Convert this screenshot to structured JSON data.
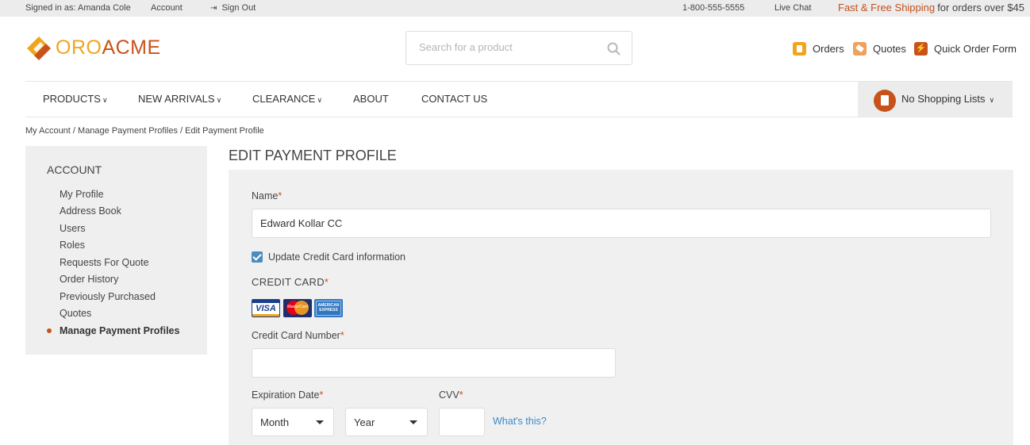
{
  "topbar": {
    "signed_in": "Signed in as: Amanda Cole",
    "account": "Account",
    "sign_out": "Sign Out",
    "phone": "1-800-555-5555",
    "live_chat": "Live Chat",
    "shipping_accent": "Fast & Free Shipping",
    "shipping_rest": "for orders over $45"
  },
  "brand": {
    "part1": "ORO",
    "part2": "ACME",
    "color1": "#f0a51d",
    "color2": "#c8531a"
  },
  "search": {
    "placeholder": "Search for a product",
    "icon": "search-icon"
  },
  "header_links": [
    {
      "label": "Orders",
      "icon": "orders-icon"
    },
    {
      "label": "Quotes",
      "icon": "quotes-icon"
    },
    {
      "label": "Quick Order Form",
      "icon": "quick-order-icon"
    }
  ],
  "nav": [
    {
      "label": "PRODUCTS",
      "dropdown": true
    },
    {
      "label": "NEW ARRIVALS",
      "dropdown": true
    },
    {
      "label": "CLEARANCE",
      "dropdown": true
    },
    {
      "label": "ABOUT",
      "dropdown": false
    },
    {
      "label": "CONTACT US",
      "dropdown": false
    }
  ],
  "shopping_lists": {
    "label": "No Shopping Lists",
    "icon": "shopping-list-icon"
  },
  "breadcrumb": "My Account / Manage Payment Profiles / Edit Payment Profile",
  "sidebar": {
    "title": "ACCOUNT",
    "items": [
      {
        "label": "My Profile",
        "active": false
      },
      {
        "label": "Address Book",
        "active": false
      },
      {
        "label": "Users",
        "active": false
      },
      {
        "label": "Roles",
        "active": false
      },
      {
        "label": "Requests For Quote",
        "active": false
      },
      {
        "label": "Order History",
        "active": false
      },
      {
        "label": "Previously Purchased",
        "active": false
      },
      {
        "label": "Quotes",
        "active": false
      },
      {
        "label": "Manage Payment Profiles",
        "active": true
      }
    ]
  },
  "form": {
    "page_title": "EDIT PAYMENT PROFILE",
    "name_label": "Name",
    "name_value": "Edward Kollar CC",
    "update_cc_label": "Update Credit Card information",
    "update_cc_checked": true,
    "credit_card_section": "CREDIT CARD",
    "card_logos": [
      "VISA",
      "MasterCard",
      "AMERICAN EXPRESS"
    ],
    "card_number_label": "Credit Card Number",
    "card_number_value": "",
    "expiration_label": "Expiration Date",
    "month_value": "Month",
    "year_value": "Year",
    "cvv_label": "CVV",
    "cvv_value": "",
    "whats_this": "What's this?",
    "required_mark": "*"
  },
  "colors": {
    "accent": "#c8531a",
    "link": "#3a8bc8",
    "checkbox": "#4b8dbf"
  }
}
